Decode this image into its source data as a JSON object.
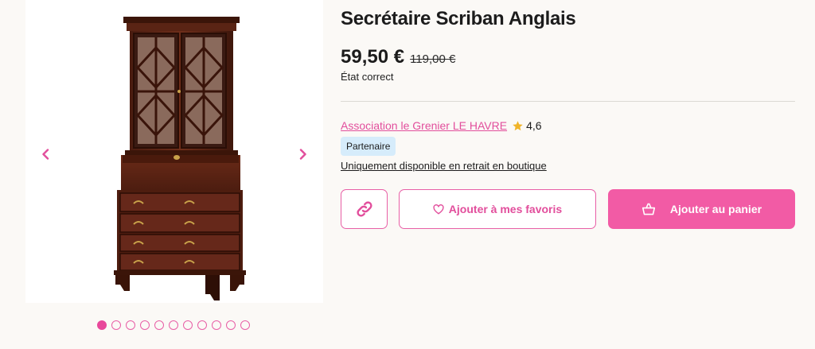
{
  "product": {
    "title": "Secrétaire Scriban Anglais",
    "price": "59,50 €",
    "old_price": "119,00 €",
    "condition": "État correct"
  },
  "seller": {
    "name": "Association le Grenier LE HAVRE",
    "rating": "4,6",
    "badge": "Partenaire",
    "pickup_note": "Uniquement disponible en retrait en boutique"
  },
  "actions": {
    "favorites_label": "Ajouter à mes favoris",
    "cart_label": "Ajouter au panier"
  },
  "gallery": {
    "image_count": 11,
    "active_index": 0
  },
  "icons": {
    "prev": "chevron-left-icon",
    "next": "chevron-right-icon",
    "link": "link-icon",
    "favorite": "heart-icon",
    "cart": "basket-icon",
    "rating": "star-icon"
  },
  "colors": {
    "accent": "#e8489b",
    "accent_button": "#f25ba5",
    "badge_bg": "#d6ecfb",
    "star": "#f0b429",
    "background": "#fbf9f6"
  }
}
